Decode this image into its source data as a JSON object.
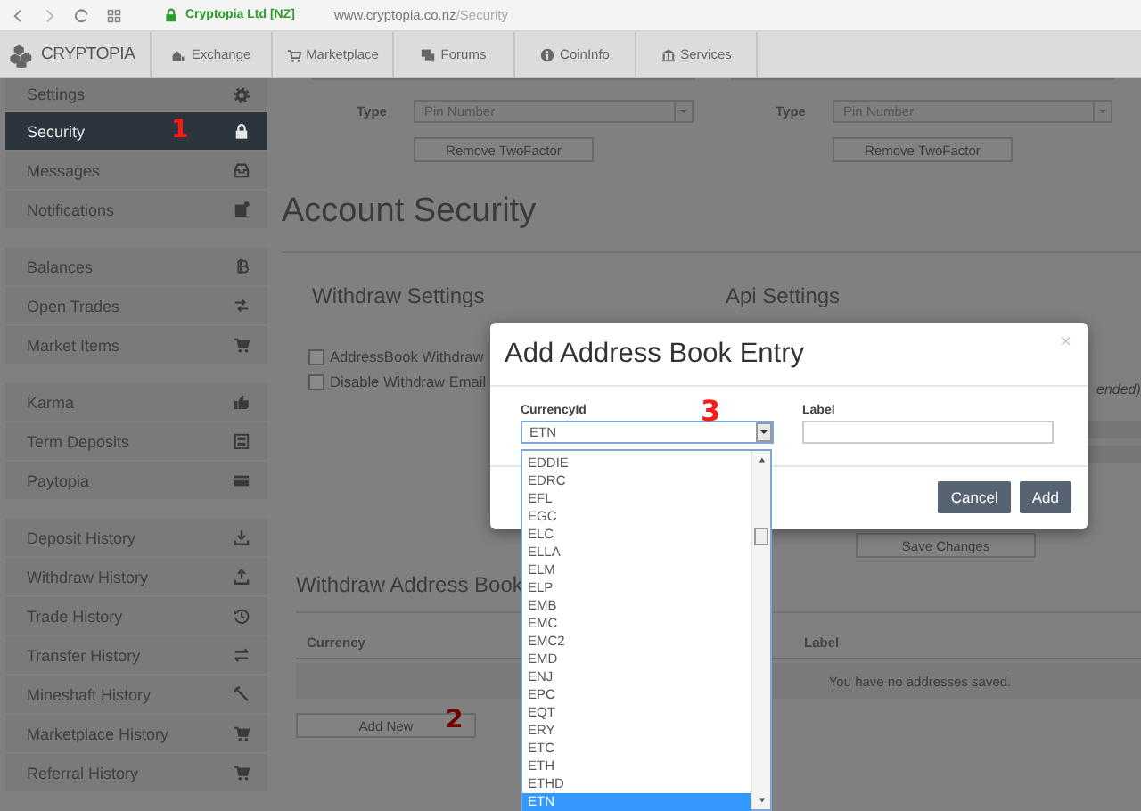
{
  "browser": {
    "site_identity": "Cryptopia Ltd [NZ]",
    "url_host": "www.cryptopia.co.nz",
    "url_path": "/Security"
  },
  "nav": {
    "logo": "CRYPTOPIA",
    "items": [
      "Exchange",
      "Marketplace",
      "Forums",
      "CoinInfo",
      "Services"
    ]
  },
  "sidebar": {
    "groups": [
      {
        "items": [
          {
            "label": "Settings",
            "selected": false
          },
          {
            "label": "Security",
            "selected": true,
            "marker": "1"
          },
          {
            "label": "Messages",
            "selected": false
          },
          {
            "label": "Notifications",
            "selected": false
          }
        ]
      },
      {
        "items": [
          {
            "label": "Balances",
            "selected": false
          },
          {
            "label": "Open Trades",
            "selected": false
          },
          {
            "label": "Market Items",
            "selected": false
          }
        ]
      },
      {
        "items": [
          {
            "label": "Karma",
            "selected": false
          },
          {
            "label": "Term Deposits",
            "selected": false
          },
          {
            "label": "Paytopia",
            "selected": false
          }
        ]
      },
      {
        "items": [
          {
            "label": "Deposit History",
            "selected": false
          },
          {
            "label": "Withdraw History",
            "selected": false
          },
          {
            "label": "Trade History",
            "selected": false
          },
          {
            "label": "Transfer History",
            "selected": false
          },
          {
            "label": "Mineshaft History",
            "selected": false
          },
          {
            "label": "Marketplace History",
            "selected": false
          },
          {
            "label": "Referral History",
            "selected": false
          }
        ]
      }
    ]
  },
  "two_factor": [
    {
      "type_label": "Type",
      "type_value": "Pin Number",
      "button": "Remove TwoFactor"
    },
    {
      "type_label": "Type",
      "type_value": "Pin Number",
      "button": "Remove TwoFactor"
    }
  ],
  "heading": "Account Security",
  "withdraw_settings": {
    "title": "Withdraw Settings",
    "options": [
      {
        "label": "AddressBook Withdraw",
        "checked": false
      },
      {
        "label": "Disable Withdraw Email",
        "checked": false
      }
    ]
  },
  "api_settings": {
    "title": "Api Settings",
    "note": "ended)",
    "button": "Save Changes"
  },
  "address_book": {
    "title": "Withdraw Address Book",
    "columns": [
      "Currency",
      "Label"
    ],
    "empty_message": "You have no addresses saved.",
    "button": "Add New",
    "marker": "2"
  },
  "modal": {
    "title": "Add Address Book Entry",
    "close": "×",
    "currency": {
      "label": "CurrencyId",
      "value": "ETN",
      "marker": "3",
      "options": [
        {
          "label": "EDDIE",
          "selected": false
        },
        {
          "label": "EDRC",
          "selected": false
        },
        {
          "label": "EFL",
          "selected": false
        },
        {
          "label": "EGC",
          "selected": false
        },
        {
          "label": "ELC",
          "selected": false
        },
        {
          "label": "ELLA",
          "selected": false
        },
        {
          "label": "ELM",
          "selected": false
        },
        {
          "label": "ELP",
          "selected": false
        },
        {
          "label": "EMB",
          "selected": false
        },
        {
          "label": "EMC",
          "selected": false
        },
        {
          "label": "EMC2",
          "selected": false
        },
        {
          "label": "EMD",
          "selected": false
        },
        {
          "label": "ENJ",
          "selected": false
        },
        {
          "label": "EPC",
          "selected": false
        },
        {
          "label": "EQT",
          "selected": false
        },
        {
          "label": "ERY",
          "selected": false
        },
        {
          "label": "ETC",
          "selected": false
        },
        {
          "label": "ETH",
          "selected": false
        },
        {
          "label": "ETHD",
          "selected": false
        },
        {
          "label": "ETN",
          "selected": true
        }
      ]
    },
    "label_field": {
      "label": "Label"
    },
    "buttons": [
      "Cancel",
      "Add"
    ]
  }
}
